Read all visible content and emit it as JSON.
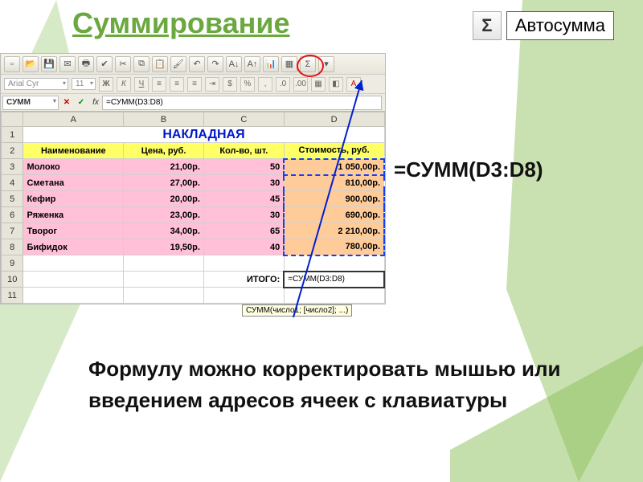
{
  "slide": {
    "title": "Суммирование",
    "autosum_label": "Автосумма",
    "sigma": "Σ",
    "formula_display": "=СУММ(D3:D8)",
    "explanation": "Формулу можно корректировать мышью или введением адресов ячеек с клавиатуры"
  },
  "toolbar": {
    "font_name": "Arial Cyr",
    "font_size": "11",
    "bold": "Ж",
    "italic": "К",
    "underline": "Ч"
  },
  "formula_bar": {
    "name_box": "СУММ",
    "formula": "=СУММ(D3:D8)"
  },
  "columns": [
    "",
    "A",
    "B",
    "C",
    "D"
  ],
  "sheet": {
    "title": "НАКЛАДНАЯ",
    "headers": [
      "Наименование",
      "Цена, руб.",
      "Кол-во, шт.",
      "Стоимость, руб."
    ],
    "rows": [
      {
        "n": "3",
        "name": "Молоко",
        "price": "21,00р.",
        "qty": "50",
        "cost": "1 050,00р."
      },
      {
        "n": "4",
        "name": "Сметана",
        "price": "27,00р.",
        "qty": "30",
        "cost": "810,00р."
      },
      {
        "n": "5",
        "name": "Кефир",
        "price": "20,00р.",
        "qty": "45",
        "cost": "900,00р."
      },
      {
        "n": "6",
        "name": "Ряженка",
        "price": "23,00р.",
        "qty": "30",
        "cost": "690,00р."
      },
      {
        "n": "7",
        "name": "Творог",
        "price": "34,00р.",
        "qty": "65",
        "cost": "2 210,00р."
      },
      {
        "n": "8",
        "name": "Бифидок",
        "price": "19,50р.",
        "qty": "40",
        "cost": "780,00р."
      }
    ],
    "row9": "9",
    "row10": "10",
    "row11": "11",
    "itogo_label": "ИТОГО:",
    "active_formula": "=СУММ(D3:D8)",
    "tooltip": "СУММ(число1; [число2]; ...)"
  },
  "chart_data": {
    "type": "table",
    "title": "НАКЛАДНАЯ",
    "columns": [
      "Наименование",
      "Цена, руб.",
      "Кол-во, шт.",
      "Стоимость, руб."
    ],
    "rows": [
      [
        "Молоко",
        21.0,
        50,
        1050.0
      ],
      [
        "Сметана",
        27.0,
        30,
        810.0
      ],
      [
        "Кефир",
        20.0,
        45,
        900.0
      ],
      [
        "Ряженка",
        23.0,
        30,
        690.0
      ],
      [
        "Творог",
        34.0,
        65,
        2210.0
      ],
      [
        "Бифидок",
        19.5,
        40,
        780.0
      ]
    ],
    "total_formula": "=СУММ(D3:D8)"
  }
}
